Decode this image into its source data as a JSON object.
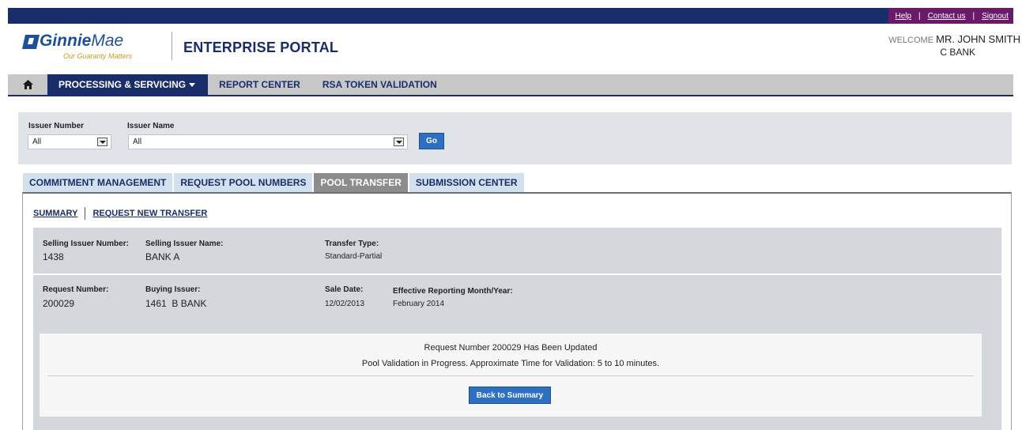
{
  "util_links": {
    "help": "Help",
    "contact": "Contact us",
    "signout": "Signout"
  },
  "header": {
    "logo_primary": "Ginnie",
    "logo_secondary": "Mae",
    "logo_tagline": "Our Guaranty Matters",
    "portal_title": "ENTERPRISE PORTAL",
    "welcome_label": "WELCOME",
    "user_name": "MR. JOHN SMITH",
    "user_bank": "C BANK"
  },
  "main_nav": {
    "home_icon": "home-icon",
    "items": [
      "PROCESSING & SERVICING",
      "REPORT CENTER",
      "RSA TOKEN VALIDATION"
    ]
  },
  "filter": {
    "issuer_number_label": "Issuer Number",
    "issuer_number_value": "All",
    "issuer_name_label": "Issuer Name",
    "issuer_name_value": "All",
    "go_label": "Go"
  },
  "sub_tabs": [
    "COMMITMENT MANAGEMENT",
    "REQUEST POOL NUMBERS",
    "POOL TRANSFER",
    "SUBMISSION CENTER"
  ],
  "sub_links": {
    "summary": "SUMMARY",
    "request_new": "REQUEST NEW TRANSFER"
  },
  "transfer": {
    "selling_issuer_number_label": "Selling Issuer Number:",
    "selling_issuer_number": "1438",
    "selling_issuer_name_label": "Selling Issuer Name:",
    "selling_issuer_name": "BANK A",
    "transfer_type_label": "Transfer Type:",
    "transfer_type": "Standard-Partial",
    "request_number_label": "Request Number:",
    "request_number": "200029",
    "buying_issuer_label": "Buying Issuer:",
    "buying_issuer": "1461  B BANK",
    "sale_date_label": "Sale Date:",
    "sale_date": "12/02/2013",
    "effective_label": "Effective Reporting Month/Year:",
    "effective_value": "February 2014"
  },
  "message": {
    "line1": "Request Number 200029 Has Been Updated",
    "line2": "Pool Validation in Progress. Approximate Time for Validation: 5 to 10 minutes.",
    "back_label": "Back to Summary"
  },
  "colors": {
    "navy": "#1a2d6b",
    "purple": "#6b1a6a",
    "button_blue": "#2d6fc0",
    "panel_gray": "#d4d7dc"
  }
}
